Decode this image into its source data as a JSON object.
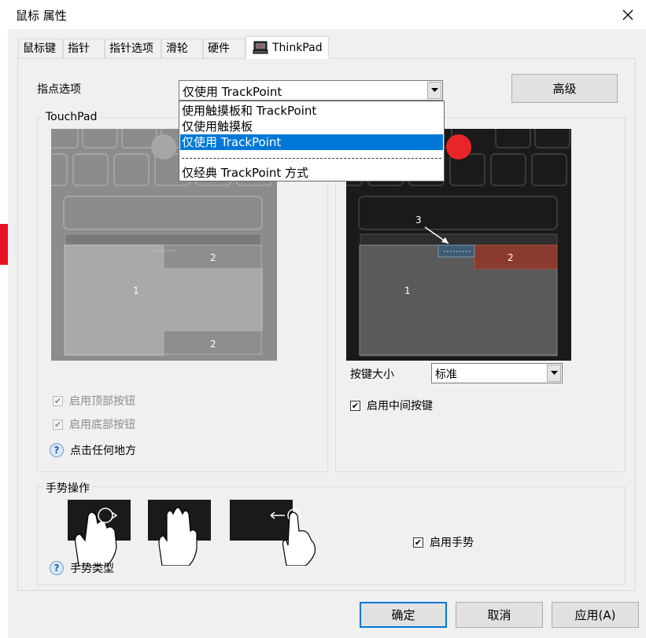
{
  "window": {
    "title": "鼠标 属性"
  },
  "tabs": [
    {
      "label": "鼠标键"
    },
    {
      "label": "指针"
    },
    {
      "label": "指针选项"
    },
    {
      "label": "滑轮"
    },
    {
      "label": "硬件"
    },
    {
      "label": "ThinkPad",
      "active": true
    }
  ],
  "pointing": {
    "label": "指点选项",
    "selected": "仅使用 TrackPoint",
    "options": [
      "使用触摸板和 TrackPoint",
      "仅使用触摸板",
      "仅使用 TrackPoint",
      "仅经典 TrackPoint 方式"
    ],
    "selected_index": 2,
    "advanced_button": "高级"
  },
  "touchpad": {
    "group_label": "TouchPad",
    "zone_labels": {
      "main": "1",
      "top_right": "2",
      "bottom_right": "2"
    },
    "enable_top_buttons": {
      "label": "启用顶部按钮",
      "checked": true,
      "enabled": false
    },
    "enable_bottom_buttons": {
      "label": "启用底部按钮",
      "checked": true,
      "enabled": false
    },
    "help_link": "点击任何地方"
  },
  "trackpoint": {
    "zone_labels": {
      "main": "1",
      "right": "2",
      "pointer": "3"
    },
    "button_size_label": "按键大小",
    "button_size_value": "标准",
    "enable_middle_button": {
      "label": "启用中间按键",
      "checked": true
    }
  },
  "gestures": {
    "group_label": "手势操作",
    "enable_gestures": {
      "label": "启用手势",
      "checked": true
    },
    "help_link": "手势类型"
  },
  "footer": {
    "ok": "确定",
    "cancel": "取消",
    "apply": "应用(A)"
  },
  "colors": {
    "selection": "#0078d7",
    "trackpoint_red": "#e8262a",
    "zone_highlight": "#8a3a2e"
  }
}
